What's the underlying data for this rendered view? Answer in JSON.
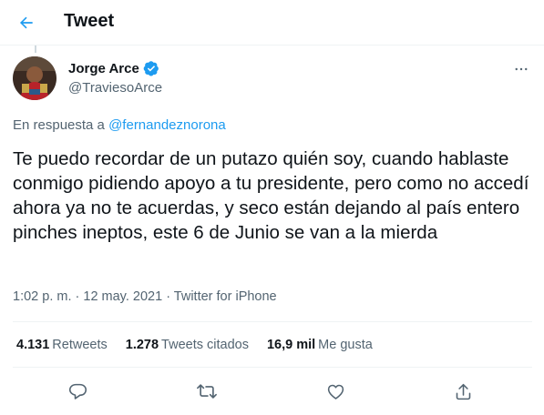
{
  "header": {
    "title": "Tweet"
  },
  "author": {
    "display_name": "Jorge Arce",
    "handle": "@TraviesoArce",
    "verified": true
  },
  "reply": {
    "prefix": "En respuesta a ",
    "target": "@fernandeznorona"
  },
  "tweet": {
    "text": "Te puedo recordar de un putazo quién soy, cuando hablaste conmigo pidiendo apoyo a tu presidente, pero como no accedí ahora ya no te acuerdas, y seco están dejando al país entero pinches ineptos, este 6 de Junio se van a la mierda"
  },
  "meta": {
    "time": "1:02 p. m.",
    "separator": " · ",
    "date": "12 may. 2021",
    "source": "Twitter for iPhone"
  },
  "stats": [
    {
      "count": "4.131",
      "label": "Retweets"
    },
    {
      "count": "1.278",
      "label": "Tweets citados"
    },
    {
      "count": "16,9 mil",
      "label": "Me gusta"
    }
  ],
  "icons": {
    "back": "arrow-left-icon",
    "verified": "verified-badge-icon",
    "more": "more-horizontal-icon",
    "reply": "reply-icon",
    "retweet": "retweet-icon",
    "like": "heart-icon",
    "share": "share-icon"
  },
  "colors": {
    "accent": "#1d9bf0",
    "text": "#0f1419",
    "secondary": "#536471",
    "divider": "#eff3f4"
  }
}
